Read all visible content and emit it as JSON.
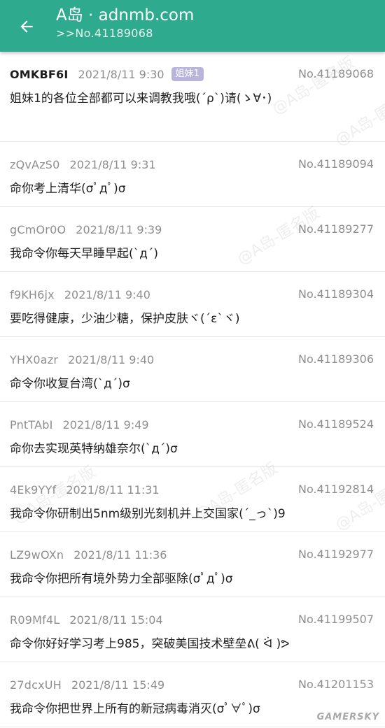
{
  "header": {
    "title": "A岛 · adnmb.com",
    "subtitle": ">>No.41189068"
  },
  "posts": [
    {
      "uid": "OMKBF6I",
      "time": "2021/8/11 9:30",
      "badge": "姐妹1",
      "no": "No.41189068",
      "content": "姐妹1的各位全部都可以来调教我哦(´ρ`)请(ゝ∀･)"
    },
    {
      "uid": "zQvAzS0",
      "time": "2021/8/11 9:31",
      "no": "No.41189094",
      "content": "命你考上清华(σﾟдﾟ)σ"
    },
    {
      "uid": "gCmOr0O",
      "time": "2021/8/11 9:39",
      "no": "No.41189277",
      "content": "我命令你每天早睡早起(`д´)"
    },
    {
      "uid": "f9KH6jx",
      "time": "2021/8/11 9:40",
      "no": "No.41189304",
      "content": "要吃得健康，少油少糖，保护皮肤ヾ(´ε`ヾ)"
    },
    {
      "uid": "YHX0azr",
      "time": "2021/8/11 9:40",
      "no": "No.41189306",
      "content": "命令你收复台湾(`д´)σ"
    },
    {
      "uid": "PntTAbI",
      "time": "2021/8/11 9:49",
      "no": "No.41189524",
      "content": "命你去实现英特纳雄奈尔(`д´)σ"
    },
    {
      "uid": "4Ek9YYf",
      "time": "2021/8/11 11:31",
      "no": "No.41192814",
      "content": "我命令你研制出5nm级别光刻机并上交国家(´_っ`)9"
    },
    {
      "uid": "LZ9wOXn",
      "time": "2021/8/11 11:36",
      "no": "No.41192977",
      "content": "我命令你把所有境外势力全部驱除(σﾟдﾟ)σ"
    },
    {
      "uid": "R09Mf4L",
      "time": "2021/8/11 15:04",
      "no": "No.41199507",
      "content": "命令你好好学习考上985，突破美国技术壁垒ᕕ( ᐛ )ᕗ"
    },
    {
      "uid": "27dcxUH",
      "time": "2021/8/11 15:49",
      "no": "No.41201153",
      "content": "我命令你把世界上所有的新冠病毒消灭(σﾟ∀ﾟ)σ"
    }
  ],
  "watermark": "@A岛-匿名版",
  "logo": "GAMERSKY",
  "colors": {
    "accent": "#2eaa8e",
    "badge": "#b9b4dc"
  },
  "icons": {
    "back": "arrow-left-icon"
  }
}
